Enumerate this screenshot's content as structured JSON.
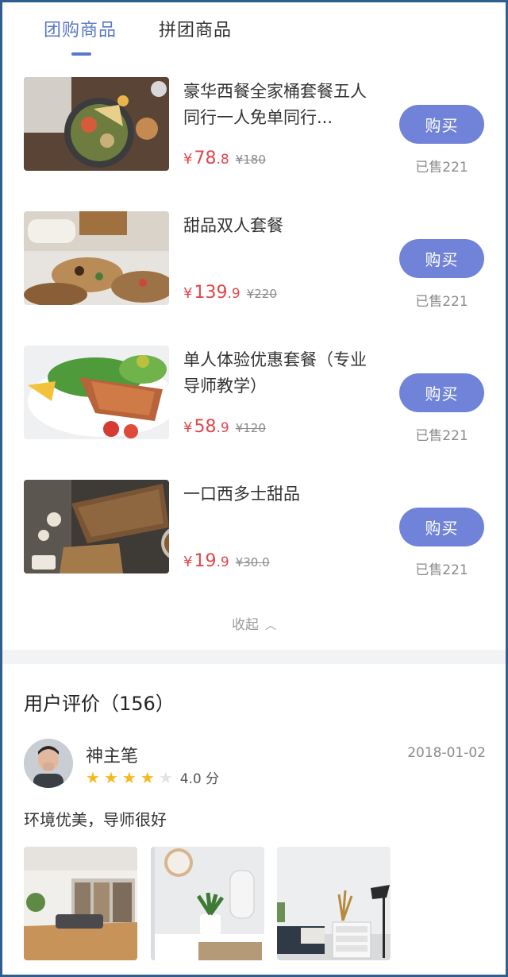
{
  "tabs": [
    {
      "label": "团购商品",
      "active": true
    },
    {
      "label": "拼团商品",
      "active": false
    }
  ],
  "products": [
    {
      "title": "豪华西餐全家桶套餐五人同行一人免单同行...",
      "currency": "¥",
      "price_int": "78",
      "price_dec": ".8",
      "original_price": "¥180",
      "button": "购买",
      "sold": "已售221"
    },
    {
      "title": "甜品双人套餐",
      "currency": "¥",
      "price_int": "139",
      "price_dec": ".9",
      "original_price": "¥220",
      "button": "购买",
      "sold": "已售221"
    },
    {
      "title": "单人体验优惠套餐（专业导师教学）",
      "currency": "¥",
      "price_int": "58",
      "price_dec": ".9",
      "original_price": "¥120",
      "button": "购买",
      "sold": "已售221"
    },
    {
      "title": "一口西多士甜品",
      "currency": "¥",
      "price_int": "19",
      "price_dec": ".9",
      "original_price": "¥30.0",
      "button": "购买",
      "sold": "已售221"
    }
  ],
  "collapse_label": "收起",
  "reviews": {
    "title": "用户评价（156）",
    "items": [
      {
        "user": "神主笔",
        "date": "2018-01-02",
        "rating": 4,
        "max_rating": 5,
        "score_text": "4.0 分",
        "text": "环境优美，导师很好"
      }
    ]
  },
  "colors": {
    "accent": "#5a78c8",
    "button": "#7083d8",
    "price": "#e0464a",
    "star": "#f6b91d"
  }
}
